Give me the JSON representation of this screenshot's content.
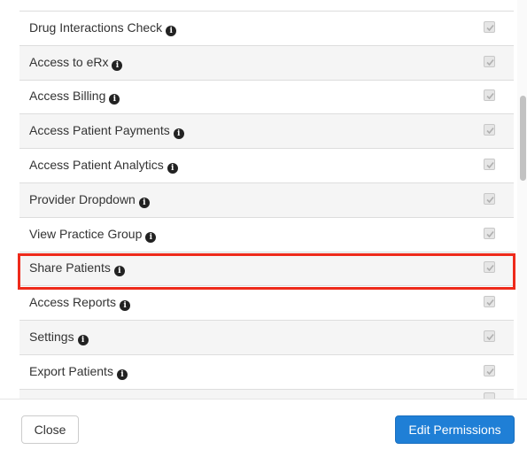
{
  "permissions": [
    {
      "label": "Drug Interactions Check",
      "checked": true
    },
    {
      "label": "Access to eRx",
      "checked": true
    },
    {
      "label": "Access Billing",
      "checked": true
    },
    {
      "label": "Access Patient Payments",
      "checked": true
    },
    {
      "label": "Access Patient Analytics",
      "checked": true
    },
    {
      "label": "Provider Dropdown",
      "checked": true
    },
    {
      "label": "View Practice Group",
      "checked": true
    },
    {
      "label": "Share Patients",
      "checked": true
    },
    {
      "label": "Access Reports",
      "checked": true
    },
    {
      "label": "Settings",
      "checked": true
    },
    {
      "label": "Export Patients",
      "checked": true
    }
  ],
  "info_icon": "info-circle-icon",
  "info_glyph": "i",
  "highlight_color": "#ee2a1b",
  "footer": {
    "close_label": "Close",
    "edit_label": "Edit Permissions"
  },
  "colors": {
    "primary_button": "#1f7fd6",
    "row_stripe": "#f5f5f5"
  }
}
